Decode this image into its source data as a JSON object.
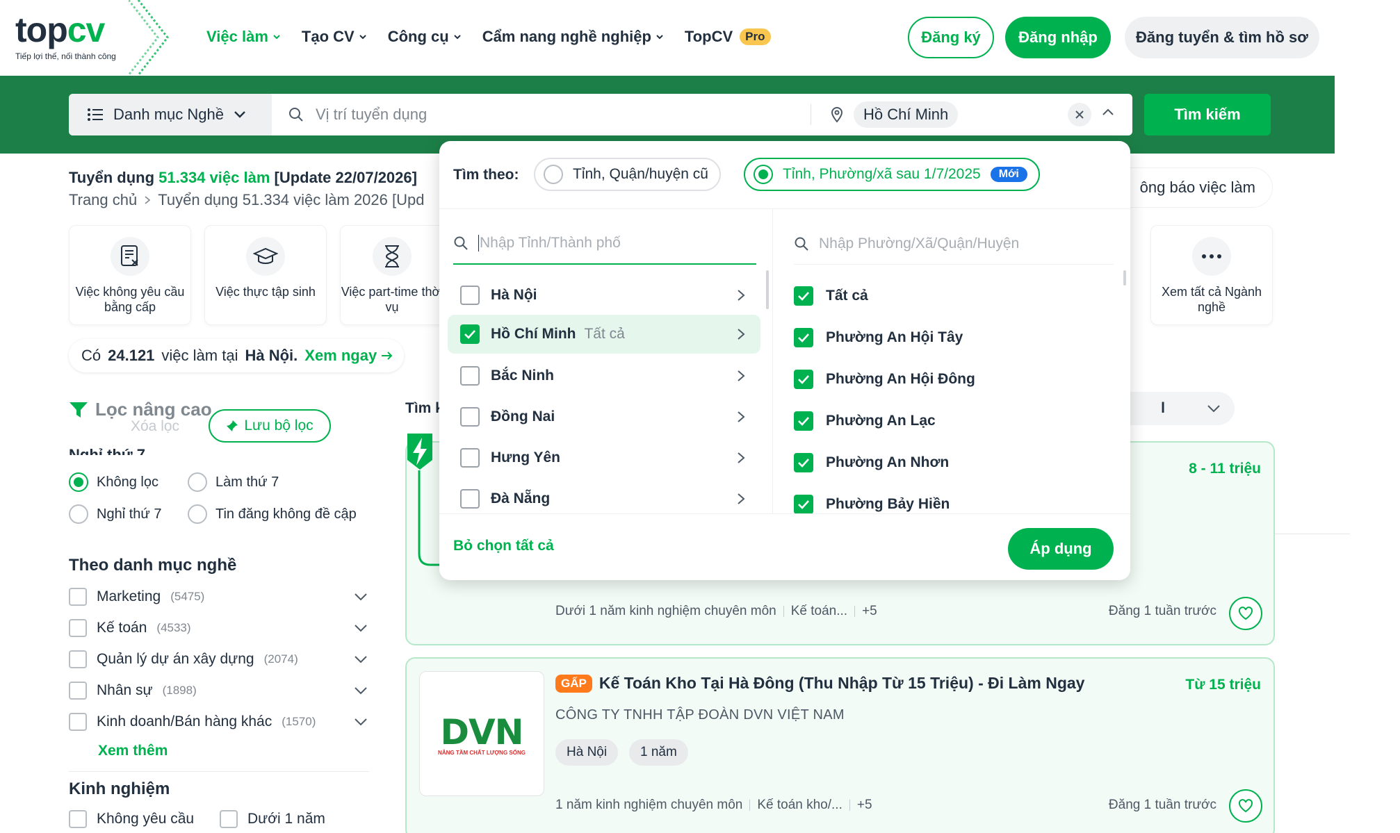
{
  "header": {
    "logo_text_top": "top",
    "logo_text_cv": "cv",
    "logo_tagline": "Tiếp lợi thế, nối thành công",
    "nav": [
      {
        "label": "Việc làm",
        "active": true
      },
      {
        "label": "Tạo CV"
      },
      {
        "label": "Công cụ"
      },
      {
        "label": "Cẩm nang nghề nghiệp"
      },
      {
        "label": "TopCV"
      }
    ],
    "pro_badge": "Pro",
    "register": "Đăng ký",
    "login": "Đăng nhập",
    "employer": "Đăng tuyển & tìm hồ sơ"
  },
  "search": {
    "category": "Danh mục Nghề",
    "keyword_placeholder": "Vị trí tuyển dụng",
    "location_chip": "Hồ Chí Minh",
    "button": "Tìm kiếm"
  },
  "summary": {
    "prefix": "Tuyển dụng",
    "count": "51.334 việc làm",
    "suffix": "[Update 22/07/2026]",
    "crumb_home": "Trang chủ",
    "crumb_current": "Tuyển dụng 51.334 việc làm 2026 [Upd",
    "notify_label": "ông báo việc làm"
  },
  "quick_categories": [
    {
      "label": "Việc không yêu cầu bằng cấp",
      "icon": "document-icon"
    },
    {
      "label": "Việc thực tập sinh",
      "icon": "graduation-cap-icon"
    },
    {
      "label": "Việc part-time thời vụ",
      "icon": "hourglass-icon"
    },
    {
      "label": "Xem tất cả Ngành nghề",
      "icon": "more-icon"
    }
  ],
  "hanoi_banner": {
    "prefix": "Có",
    "count": "24.121",
    "mid": "việc làm tại",
    "city": "Hà Nội.",
    "link": "Xem ngay"
  },
  "filters": {
    "title": "Lọc nâng cao",
    "clear": "Xóa lọc",
    "save": "Lưu bộ lọc",
    "saturday_title": "Nghỉ thứ 7",
    "saturday_options": [
      {
        "label": "Không lọc",
        "selected": true
      },
      {
        "label": "Làm thứ 7"
      },
      {
        "label": "Nghỉ thứ 7"
      },
      {
        "label": "Tin đăng không đề cập"
      }
    ],
    "category_title": "Theo danh mục nghề",
    "categories": [
      {
        "label": "Marketing",
        "count": "(5475)"
      },
      {
        "label": "Kế toán",
        "count": "(4533)"
      },
      {
        "label": "Quản lý dự án xây dựng",
        "count": "(2074)"
      },
      {
        "label": "Nhân sự",
        "count": "(1898)"
      },
      {
        "label": "Kinh doanh/Bán hàng khác",
        "count": "(1570)"
      }
    ],
    "more": "Xem thêm",
    "experience_title": "Kinh nghiệm",
    "experience_options": [
      "Không yêu cầu",
      "Dưới 1 năm"
    ]
  },
  "job_list": {
    "head": "Tìm k",
    "sort_tail": "l",
    "jobs": [
      {
        "salary": "8 - 11 triệu",
        "meta": [
          "Dưới 1 năm kinh nghiệm chuyên môn",
          "Kế toán...",
          "+5"
        ],
        "posted": "Đăng 1 tuần trước"
      },
      {
        "urgent": "GẤP",
        "title": "Kế Toán Kho Tại Hà Đông (Thu Nhập Từ 15 Triệu) - Đi Làm Ngay",
        "company": "CÔNG TY TNHH TẬP ĐOÀN DVN VIỆT NAM",
        "logo_text": "DVN",
        "logo_sub": "NÂNG TẦM CHẤT LƯỢNG SỐNG",
        "salary": "Từ 15 triệu",
        "tags": [
          "Hà Nội",
          "1 năm"
        ],
        "meta": [
          "1 năm kinh nghiệm chuyên môn",
          "Kế toán kho/...",
          "+5"
        ],
        "posted": "Đăng 1 tuần trước"
      }
    ]
  },
  "location_popup": {
    "search_by": "Tìm theo:",
    "option_old": "Tỉnh, Quận/huyện cũ",
    "option_new": "Tỉnh, Phường/xã sau 1/7/2025",
    "new_badge": "Mới",
    "province_placeholder": "Nhập Tỉnh/Thành phố",
    "ward_placeholder": "Nhập Phường/Xã/Quận/Huyện",
    "provinces": [
      {
        "name": "Hà Nội",
        "checked": false
      },
      {
        "name": "Hồ Chí Minh",
        "checked": true,
        "note": "Tất cả"
      },
      {
        "name": "Bắc Ninh",
        "checked": false
      },
      {
        "name": "Đồng Nai",
        "checked": false
      },
      {
        "name": "Hưng Yên",
        "checked": false
      },
      {
        "name": "Đà Nẵng",
        "checked": false
      }
    ],
    "wards": [
      "Tất cả",
      "Phường An Hội Tây",
      "Phường An Hội Đông",
      "Phường An Lạc",
      "Phường An Nhơn",
      "Phường Bảy Hiền"
    ],
    "unselect_all": "Bỏ chọn tất cả",
    "apply": "Áp dụng"
  },
  "colors": {
    "brand": "#00b14f",
    "band": "#1c7f47",
    "urgent": "#ff7a1a",
    "new_badge": "#1a73e8"
  }
}
